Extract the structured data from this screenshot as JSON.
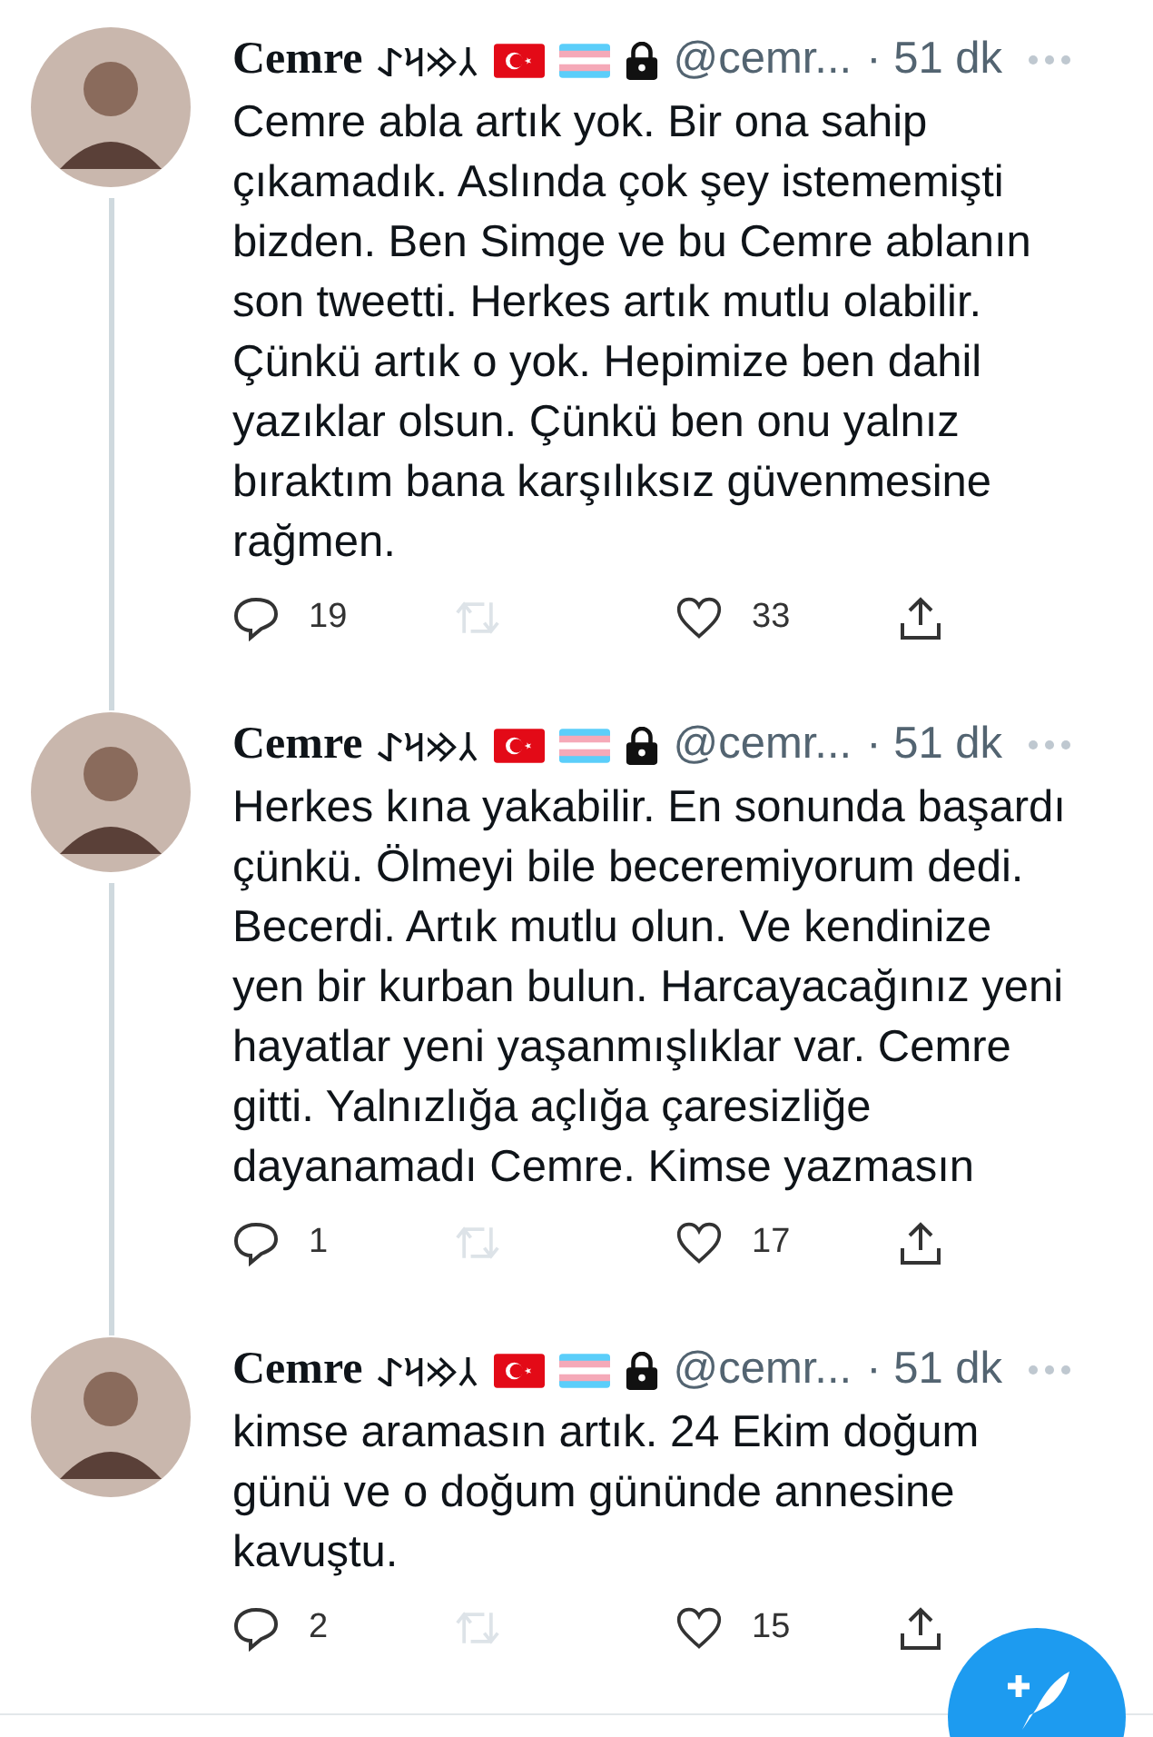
{
  "tweets": [
    {
      "name": "Cemre",
      "name_script": "𐰲𐰢𐰺𐰀",
      "protected": true,
      "handle": "@cemr...",
      "time": "· 51 dk",
      "text": "Cemre abla artık yok. Bir ona sahip\nçıkamadık. Aslında çok şey istememişti\nbizden. Ben Simge ve bu Cemre ablanın\nson tweetti. Herkes artık mutlu olabilir.\nÇünkü artık o yok. Hepimize ben dahil\nyazıklar olsun. Çünkü ben onu yalnız\nbıraktım bana karşılıksız güvenmesine\nrağmen.",
      "replies": "19",
      "likes": "33",
      "retweet_disabled": true,
      "thread_line": true
    },
    {
      "name": "Cemre",
      "name_script": "𐰲𐰢𐰺𐰀",
      "protected": true,
      "handle": "@cemr...",
      "time": "· 51 dk",
      "text": "Herkes kına yakabilir. En sonunda başardı\nçünkü. Ölmeyi bile beceremiyorum dedi.\nBecerdi. Artık mutlu olun. Ve kendinize\nyen bir kurban bulun. Harcayacağınız yeni\nhayatlar yeni yaşanmışlıklar var. Cemre\ngitti. Yalnızlığa açlığa çaresizliğe\ndayanamadı Cemre. Kimse yazmasın",
      "replies": "1",
      "likes": "17",
      "retweet_disabled": true,
      "thread_line": true
    },
    {
      "name": "Cemre",
      "name_script": "𐰲𐰢𐰺𐰀",
      "protected": true,
      "handle": "@cemr...",
      "time": "· 51 dk",
      "text": "kimse aramasın artık. 24 Ekim doğum\ngünü ve o doğum gününde annesine\nkavuştu.",
      "replies": "2",
      "likes": "15",
      "retweet_disabled": true,
      "thread_line": false
    }
  ]
}
